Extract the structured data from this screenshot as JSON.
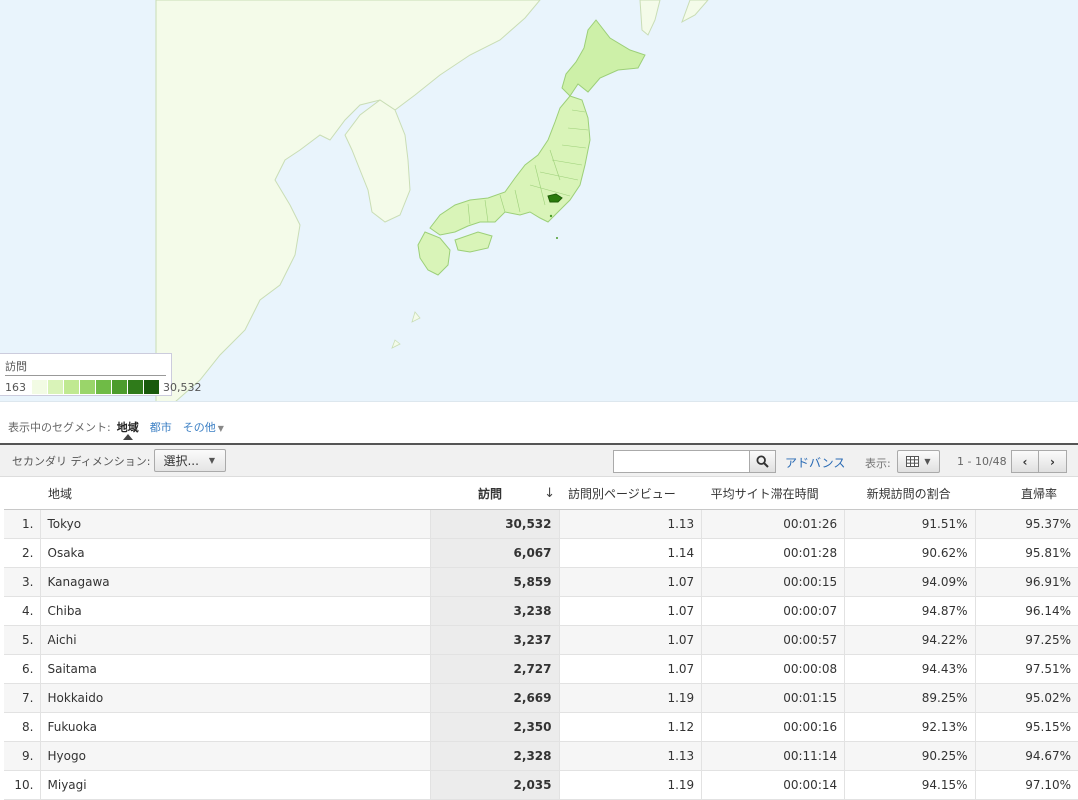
{
  "map": {
    "legend": {
      "title": "訪問",
      "min": "163",
      "max": "30,532",
      "scale_colors": [
        "#f2fbe4",
        "#d9f3b8",
        "#c0e991",
        "#9ad56a",
        "#6fbb46",
        "#4c9c2c",
        "#2f7b1a",
        "#195a0c"
      ]
    },
    "colors": {
      "sea": "#e9f4fc",
      "land": "#f4fbe9",
      "japan": "#d5f2b3",
      "tokyo": "#2a7a0c"
    }
  },
  "segments": {
    "label": "表示中のセグメント:",
    "items": [
      {
        "label": "地域",
        "active": true
      },
      {
        "label": "都市",
        "active": false
      },
      {
        "label": "その他",
        "active": false
      }
    ]
  },
  "toolbar": {
    "secondary_dimension_label": "セカンダリ ディメンション:",
    "select_label": "選択...",
    "search_placeholder": "",
    "advance_label": "アドバンス",
    "view_label": "表示:",
    "range_label": "1 - 10/48"
  },
  "table": {
    "headers": {
      "region": "地域",
      "visits": "訪問",
      "pages_per_visit": "訪問別ページビュー",
      "avg_duration": "平均サイト滞在時間",
      "new_visits": "新規訪問の割合",
      "bounce": "直帰率"
    },
    "rows": [
      {
        "idx": "1.",
        "region": "Tokyo",
        "visits": "30,532",
        "ppv": "1.13",
        "dur": "00:01:26",
        "new": "91.51%",
        "bounce": "95.37%"
      },
      {
        "idx": "2.",
        "region": "Osaka",
        "visits": "6,067",
        "ppv": "1.14",
        "dur": "00:01:28",
        "new": "90.62%",
        "bounce": "95.81%"
      },
      {
        "idx": "3.",
        "region": "Kanagawa",
        "visits": "5,859",
        "ppv": "1.07",
        "dur": "00:00:15",
        "new": "94.09%",
        "bounce": "96.91%"
      },
      {
        "idx": "4.",
        "region": "Chiba",
        "visits": "3,238",
        "ppv": "1.07",
        "dur": "00:00:07",
        "new": "94.87%",
        "bounce": "96.14%"
      },
      {
        "idx": "5.",
        "region": "Aichi",
        "visits": "3,237",
        "ppv": "1.07",
        "dur": "00:00:57",
        "new": "94.22%",
        "bounce": "97.25%"
      },
      {
        "idx": "6.",
        "region": "Saitama",
        "visits": "2,727",
        "ppv": "1.07",
        "dur": "00:00:08",
        "new": "94.43%",
        "bounce": "97.51%"
      },
      {
        "idx": "7.",
        "region": "Hokkaido",
        "visits": "2,669",
        "ppv": "1.19",
        "dur": "00:01:15",
        "new": "89.25%",
        "bounce": "95.02%"
      },
      {
        "idx": "8.",
        "region": "Fukuoka",
        "visits": "2,350",
        "ppv": "1.12",
        "dur": "00:00:16",
        "new": "92.13%",
        "bounce": "95.15%"
      },
      {
        "idx": "9.",
        "region": "Hyogo",
        "visits": "2,328",
        "ppv": "1.13",
        "dur": "00:11:14",
        "new": "90.25%",
        "bounce": "94.67%"
      },
      {
        "idx": "10.",
        "region": "Miyagi",
        "visits": "2,035",
        "ppv": "1.19",
        "dur": "00:00:14",
        "new": "94.15%",
        "bounce": "97.10%"
      }
    ]
  }
}
